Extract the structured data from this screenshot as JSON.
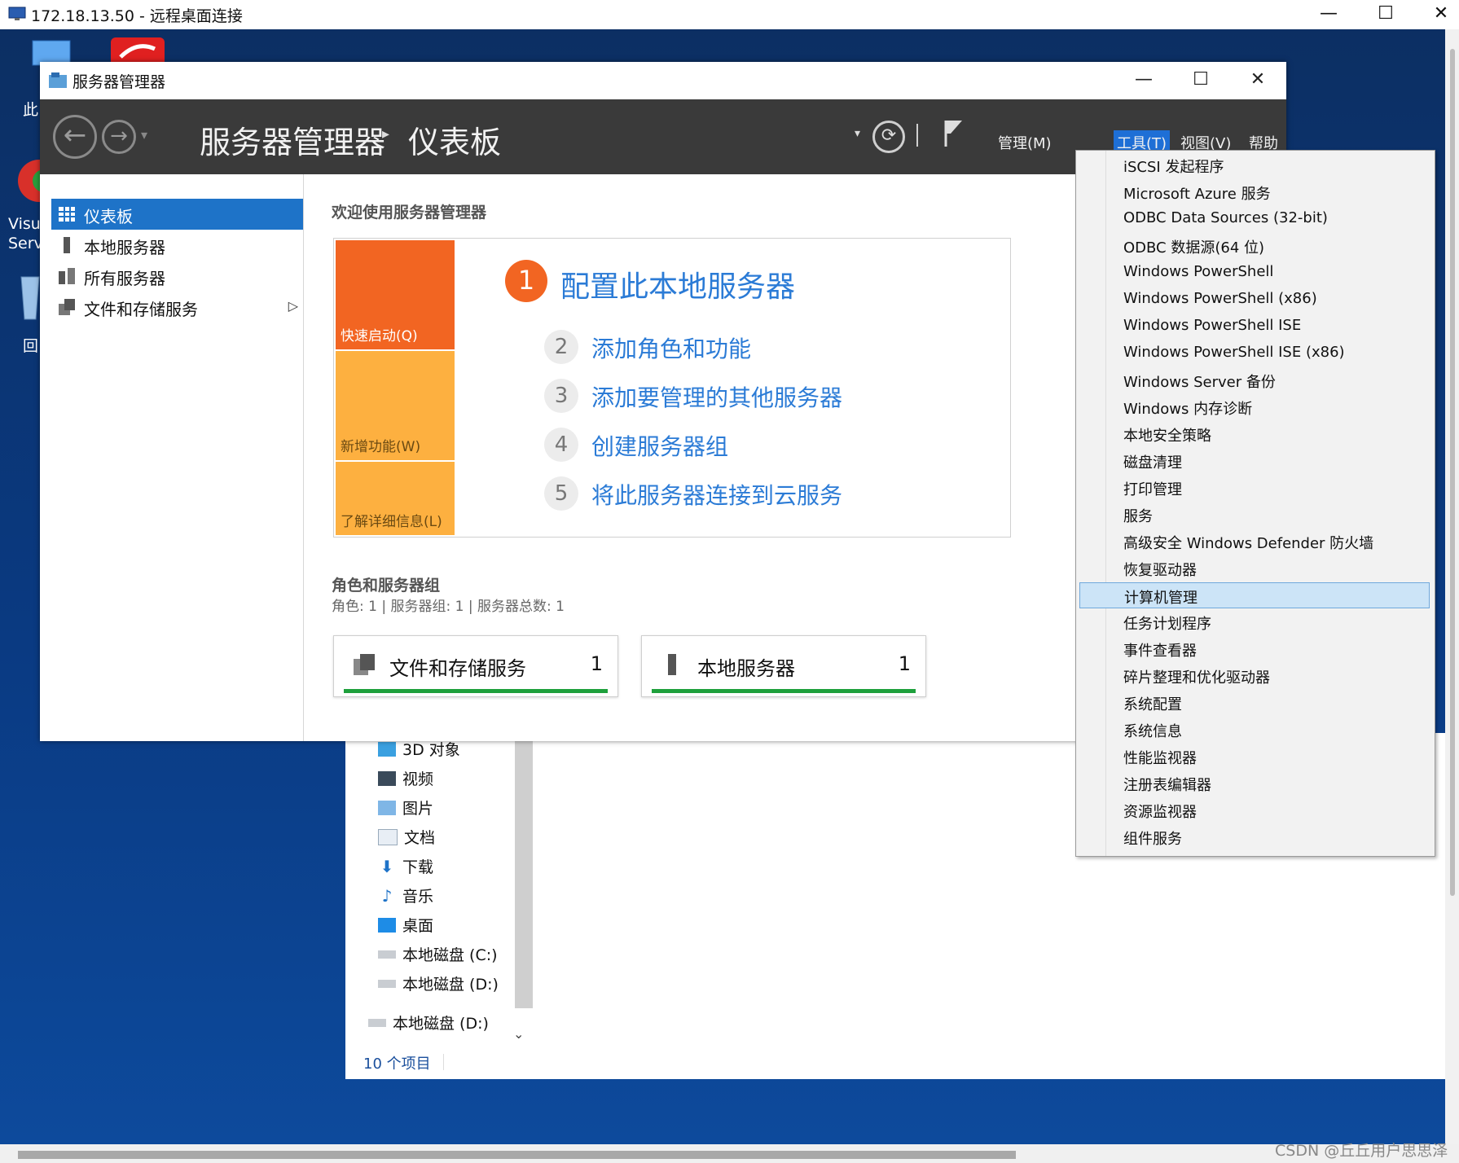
{
  "rdp": {
    "title": "172.18.13.50 - 远程桌面连接",
    "minimize": "—",
    "maximize": "☐",
    "close": "✕"
  },
  "desktop": {
    "icons": [
      {
        "label": "此",
        "icon": "this-pc-icon"
      },
      {
        "label": "Visu",
        "icon": "visual-studio-icon"
      },
      {
        "label": "Serv",
        "icon": "visual-studio-icon"
      },
      {
        "label": "回",
        "icon": "recycle-bin-icon"
      }
    ]
  },
  "explorer": {
    "tree": [
      {
        "label": "3D 对象",
        "icon": "3d-objects-icon"
      },
      {
        "label": "视频",
        "icon": "video-icon"
      },
      {
        "label": "图片",
        "icon": "pictures-icon"
      },
      {
        "label": "文档",
        "icon": "documents-icon"
      },
      {
        "label": "下载",
        "icon": "download-icon"
      },
      {
        "label": "音乐",
        "icon": "music-icon"
      },
      {
        "label": "桌面",
        "icon": "desktop-icon"
      },
      {
        "label": "本地磁盘 (C:)",
        "icon": "drive-icon"
      },
      {
        "label": "本地磁盘 (D:)",
        "icon": "drive-icon"
      },
      {
        "label": "本地磁盘 (D:)",
        "icon": "drive-icon"
      }
    ],
    "status": "10 个项目"
  },
  "server_manager": {
    "window_title": "服务器管理器",
    "breadcrumb_root": "服务器管理器",
    "breadcrumb_sep": "▸",
    "breadcrumb_page": "仪表板",
    "menus": {
      "manage": "管理(M)",
      "tools": "工具(T)",
      "view": "视图(V)",
      "help": "帮助(H)"
    },
    "nav": [
      {
        "label": "仪表板",
        "icon": "dashboard-icon",
        "selected": true
      },
      {
        "label": "本地服务器",
        "icon": "server-icon"
      },
      {
        "label": "所有服务器",
        "icon": "servers-icon"
      },
      {
        "label": "文件和存储服务",
        "icon": "file-storage-icon",
        "has_arrow": true
      }
    ],
    "welcome": "欢迎使用服务器管理器",
    "tiles": {
      "quick_start": "快速启动(Q)",
      "whats_new": "新增功能(W)",
      "learn_more": "了解详细信息(L)"
    },
    "steps": [
      {
        "num": "1",
        "text": "配置此本地服务器"
      },
      {
        "num": "2",
        "text": "添加角色和功能"
      },
      {
        "num": "3",
        "text": "添加要管理的其他服务器"
      },
      {
        "num": "4",
        "text": "创建服务器组"
      },
      {
        "num": "5",
        "text": "将此服务器连接到云服务"
      }
    ],
    "roles_title": "角色和服务器组",
    "roles_sub": "角色: 1 | 服务器组: 1 | 服务器总数: 1",
    "cards": [
      {
        "name": "文件和存储服务",
        "count": "1"
      },
      {
        "name": "本地服务器",
        "count": "1"
      }
    ]
  },
  "tools_menu": {
    "items": [
      "iSCSI 发起程序",
      "Microsoft Azure 服务",
      "ODBC Data Sources (32-bit)",
      "ODBC 数据源(64 位)",
      "Windows PowerShell",
      "Windows PowerShell (x86)",
      "Windows PowerShell ISE",
      "Windows PowerShell ISE (x86)",
      "Windows Server 备份",
      "Windows 内存诊断",
      "本地安全策略",
      "磁盘清理",
      "打印管理",
      "服务",
      "高级安全 Windows Defender 防火墙",
      "恢复驱动器",
      "计算机管理",
      "任务计划程序",
      "事件查看器",
      "碎片整理和优化驱动器",
      "系统配置",
      "系统信息",
      "性能监视器",
      "注册表编辑器",
      "资源监视器",
      "组件服务"
    ],
    "highlighted": "计算机管理"
  },
  "watermark": "CSDN @丘丘用户思思泽",
  "colors": {
    "accent_blue": "#1e73c8",
    "quick_start_orange": "#f26522",
    "tile_yellow": "#fdb040",
    "link_blue": "#2b7bd6",
    "status_green": "#1ea03c"
  }
}
